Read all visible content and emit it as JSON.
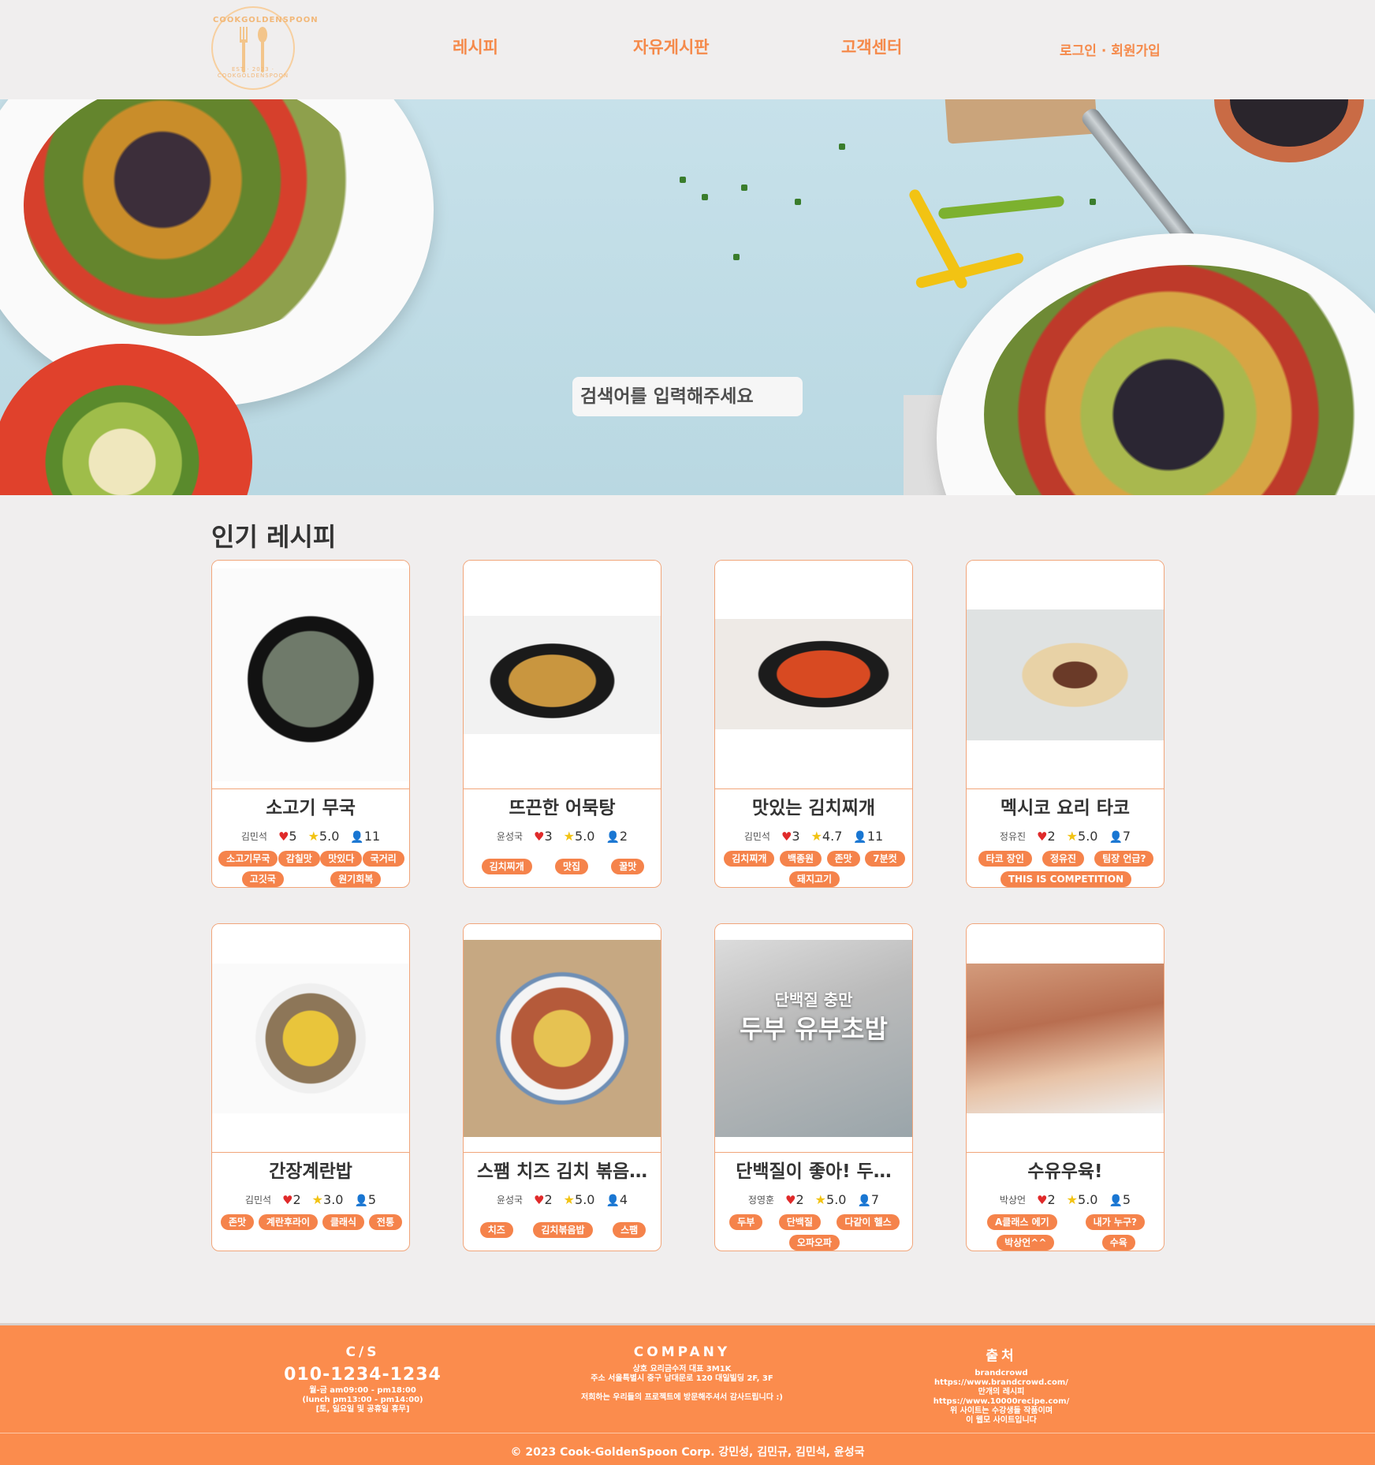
{
  "header": {
    "logo_text": "COOKGOLDENSPOON",
    "logo_sub": "EST · 2023 · COOKGOLDENSPOON",
    "nav": [
      "레시피",
      "자유게시판",
      "고객센터",
      "로그인 · 회원가입"
    ]
  },
  "hero": {
    "search_placeholder": "검색어를 입력해주세요"
  },
  "section": {
    "title": "인기 레시피"
  },
  "recipes": [
    {
      "title": "소고기 무국",
      "author": "김민석",
      "likes": "5",
      "rating": "5.0",
      "views": "11",
      "tags": [
        "소고기무국",
        "감칠맛",
        "맛있다",
        "국거리",
        "고깃국",
        "원기회복"
      ]
    },
    {
      "title": "뜨끈한 어묵탕",
      "author": "윤성국",
      "likes": "3",
      "rating": "5.0",
      "views": "2",
      "tags": [
        "김치찌개",
        "맛집",
        "꿀맛"
      ]
    },
    {
      "title": "맛있는 김치찌개",
      "author": "김민석",
      "likes": "3",
      "rating": "4.7",
      "views": "11",
      "tags": [
        "김치찌개",
        "백종원",
        "존맛",
        "7분컷",
        "돼지고기"
      ]
    },
    {
      "title": "멕시코 요리 타코",
      "author": "정유진",
      "likes": "2",
      "rating": "5.0",
      "views": "7",
      "tags": [
        "타코 장인",
        "정유진",
        "팀장 언급?",
        "THIS IS COMPETITION"
      ]
    },
    {
      "title": "간장계란밥",
      "author": "김민석",
      "likes": "2",
      "rating": "3.0",
      "views": "5",
      "tags": [
        "존맛",
        "계란후라이",
        "클래식",
        "전통"
      ]
    },
    {
      "title": "스팸 치즈 김치 볶음…",
      "author": "윤성국",
      "likes": "2",
      "rating": "5.0",
      "views": "4",
      "tags": [
        "치즈",
        "김치볶음밥",
        "스팸"
      ]
    },
    {
      "title": "단백질이 좋아! 두…",
      "author": "정영훈",
      "likes": "2",
      "rating": "5.0",
      "views": "7",
      "tags": [
        "두부",
        "단백질",
        "다같이 헬스",
        "오파오파"
      ],
      "image_caption_small": "단백질 충만",
      "image_caption_big": "두부 유부초밥"
    },
    {
      "title": "수유우육!",
      "author": "박상언",
      "likes": "2",
      "rating": "5.0",
      "views": "5",
      "tags": [
        "A클래스 에기",
        "내가 누구?",
        "박상언^^",
        "수육"
      ]
    }
  ],
  "footer": {
    "cs": {
      "heading": "C/S",
      "phone": "010-1234-1234",
      "hours": [
        "월-금 am09:00 - pm18:00",
        "(lunch pm13:00 - pm14:00)",
        "[토, 일요일 및 공휴일 휴무]"
      ]
    },
    "company": {
      "heading": "COMPANY",
      "lines": [
        "상호 요리금수저 대표 3M1K",
        "주소 서울특별시 중구 남대문로 120 대일빌딩 2F, 3F",
        "",
        "저희하는 우리들의 프로젝트에 방문해주셔서 감사드립니다 :)"
      ]
    },
    "source": {
      "heading": "출처",
      "lines": [
        "brandcrowd",
        "https://www.brandcrowd.com/",
        "만개의 레시피",
        "https://www.10000recipe.com/",
        "위 사이트는 수강생들 작품이며",
        "이 웹모 사이트입니다"
      ]
    },
    "copyright": "© 2023 Cook-GoldenSpoon Corp. 강민성, 김민규, 김민석, 윤성국"
  }
}
